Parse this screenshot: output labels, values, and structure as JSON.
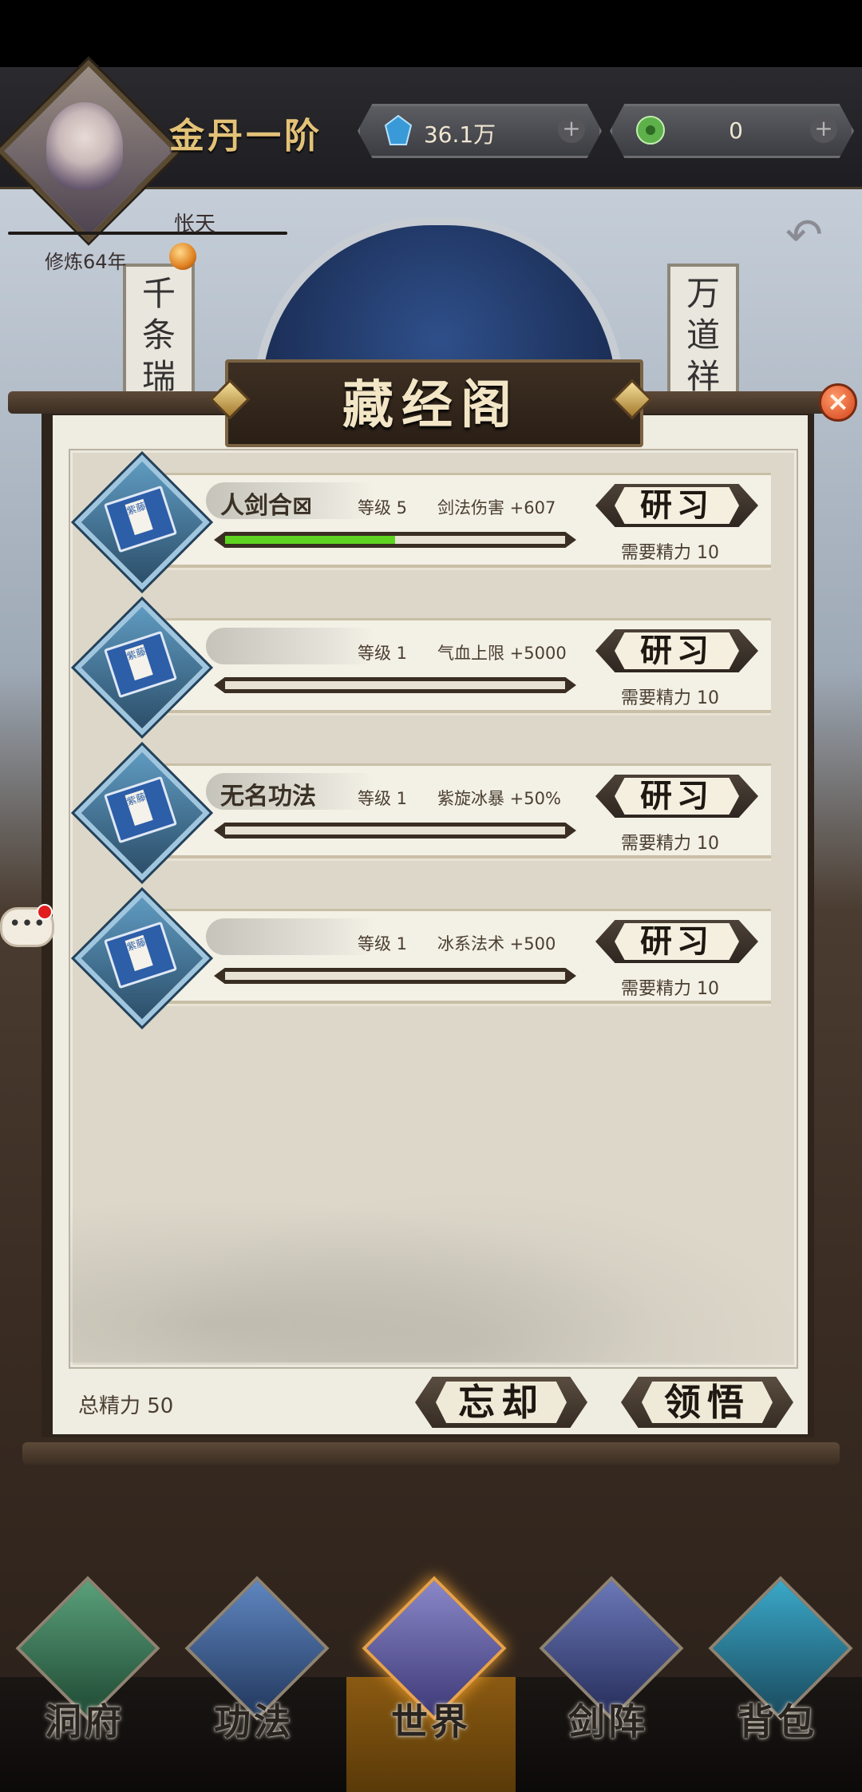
{
  "top_bar": {
    "realm": "金丹一阶",
    "player_name": "怅天",
    "cultivation": "修炼64年",
    "spirit_stones": "36.1万",
    "jade": "0",
    "plus_label": "+"
  },
  "banners": {
    "left": "千条瑞",
    "right": "万道祥"
  },
  "panel": {
    "title": "藏经阁",
    "close_label": "×"
  },
  "skills": [
    {
      "name": "人剑合⊠",
      "level": "等级 5",
      "effect": "剑法伤害 +607",
      "progress": 0.5,
      "button": "研习",
      "cost": "需要精力 10"
    },
    {
      "name": "",
      "level": "等级 1",
      "effect": "气血上限 +5000",
      "progress": 0,
      "button": "研习",
      "cost": "需要精力 10"
    },
    {
      "name": "无名功法",
      "level": "等级 1",
      "effect": "紫旋冰暴 +50%",
      "progress": 0,
      "button": "研习",
      "cost": "需要精力 10"
    },
    {
      "name": "",
      "level": "等级 1",
      "effect": "冰系法术 +500",
      "progress": 0,
      "button": "研习",
      "cost": "需要精力 10"
    }
  ],
  "book_label": "紫藤",
  "footer": {
    "total_energy": "总精力 50",
    "forget_button": "忘却",
    "comprehend_button": "领悟"
  },
  "chat": {
    "label": "•••"
  },
  "nav": [
    {
      "label": "洞府"
    },
    {
      "label": "功法"
    },
    {
      "label": "世界"
    },
    {
      "label": "剑阵"
    },
    {
      "label": "背包"
    }
  ],
  "colors": {
    "progress_fill": "#5ed420",
    "accent_gold": "#e3c278",
    "close_red": "#d2431a"
  },
  "icons": {
    "spirit_stone": "blue-crystal-icon",
    "jade": "green-jade-icon",
    "skill": "book-icon",
    "back": "back-arrow-icon"
  }
}
